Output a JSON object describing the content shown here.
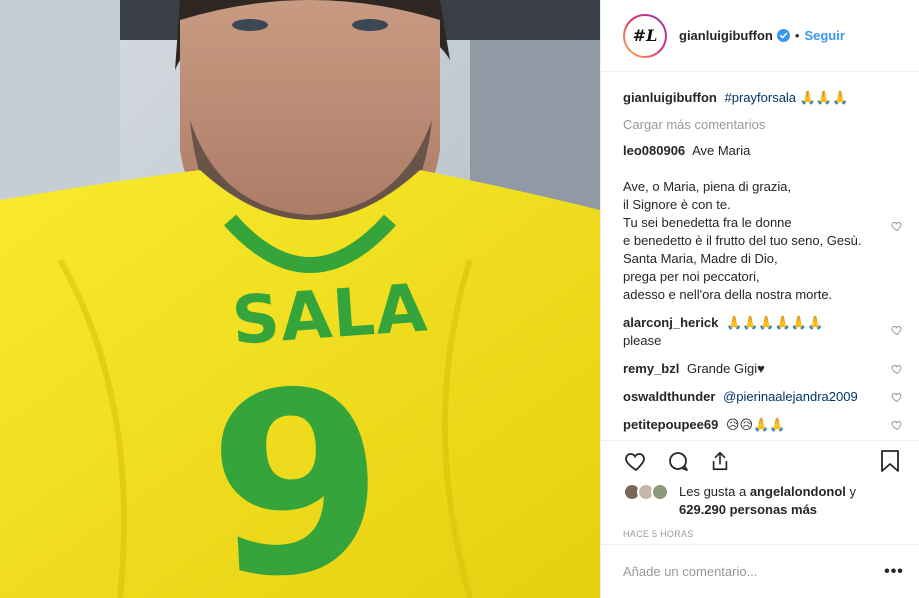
{
  "header": {
    "avatar_text": "#L",
    "username": "gianluigibuffon",
    "dot": "•",
    "follow_label": "Seguir"
  },
  "photo": {
    "jersey_name": "SALA",
    "jersey_number": "9",
    "shirt_color": "#f6e21a",
    "print_color": "#35a53b"
  },
  "caption": {
    "user": "gianluigibuffon",
    "hashtag": "#prayforsala",
    "emoji": "🙏🙏🙏"
  },
  "load_more_label": "Cargar más comentarios",
  "comments": [
    {
      "user": "leo080906",
      "text": "Ave Maria\n\nAve, o Maria, piena di grazia,\nil Signore è con te.\nTu sei benedetta fra le donne\ne benedetto è il frutto del tuo seno, Gesù.\nSanta Maria, Madre di Dio,\nprega per noi peccatori,\nadesso e nell'ora della nostra morte."
    },
    {
      "user": "alarconj_herick",
      "text": "🙏🙏🙏🙏🙏🙏\nplease"
    },
    {
      "user": "remy_bzl",
      "text": "Grande Gigi♥"
    },
    {
      "user": "oswaldthunder",
      "mention": "@pierinaalejandra2009",
      "text": ""
    },
    {
      "user": "petitepoupee69",
      "text": "😥😥🙏🙏"
    }
  ],
  "likes": {
    "prefix": "Les gusta a ",
    "user": "angelalondonol",
    "middle": " y",
    "count": "629.290 personas más"
  },
  "timestamp": "HACE 5 HORAS",
  "add_comment_placeholder": "Añade un comentario...",
  "more_label": "•••",
  "icons": [
    "heart-icon",
    "comment-icon",
    "share-icon",
    "bookmark-icon",
    "verified-icon"
  ],
  "colors": {
    "accent": "#3897f0",
    "link": "#003569",
    "muted": "#999999",
    "border": "#efefef"
  }
}
